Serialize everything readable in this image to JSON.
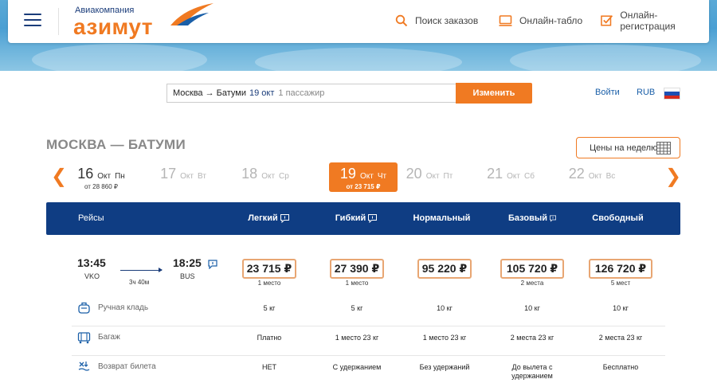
{
  "header": {
    "logo_sub": "Авиакомпания",
    "logo_main": "азимут",
    "nav": [
      {
        "label": "Поиск заказов",
        "icon": "search-icon"
      },
      {
        "label": "Онлайн-табло",
        "icon": "monitor-icon"
      },
      {
        "label": "Онлайн-регистрация",
        "icon": "checkbox-icon"
      }
    ]
  },
  "search": {
    "route": "Москва → Батуми",
    "date": "19 окт",
    "passengers": "1 пассажир",
    "change_label": "Изменить",
    "login_label": "Войти",
    "currency": "RUB"
  },
  "route_title": "МОСКВА — БАТУМИ",
  "week_prices_label": "Цены на неделю",
  "dates": [
    {
      "num": "16",
      "mon": "Окт",
      "wd": "Пн",
      "price": "от 28 860 ₽",
      "state": "avail"
    },
    {
      "num": "17",
      "mon": "Окт",
      "wd": "Вт",
      "price": "",
      "state": "dim"
    },
    {
      "num": "18",
      "mon": "Окт",
      "wd": "Ср",
      "price": "",
      "state": "dim"
    },
    {
      "num": "19",
      "mon": "Окт",
      "wd": "Чт",
      "price": "от 23 715 ₽",
      "state": "sel"
    },
    {
      "num": "20",
      "mon": "Окт",
      "wd": "Пт",
      "price": "",
      "state": "dim"
    },
    {
      "num": "21",
      "mon": "Окт",
      "wd": "Сб",
      "price": "",
      "state": "dim"
    },
    {
      "num": "22",
      "mon": "Окт",
      "wd": "Вс",
      "price": "",
      "state": "dim"
    }
  ],
  "table": {
    "flights_label": "Рейсы",
    "fares": [
      "Легкий",
      "Гибкий",
      "Нормальный",
      "Базовый",
      "Свободный"
    ]
  },
  "flight": {
    "dep_time": "13:45",
    "dep_airport": "VKO",
    "arr_time": "18:25",
    "arr_airport": "BUS",
    "duration": "3ч 40м",
    "prices": [
      "23 715 ₽",
      "27 390 ₽",
      "95 220 ₽",
      "105 720 ₽",
      "126 720 ₽"
    ],
    "seats": [
      "1 место",
      "1 место",
      "",
      "2 места",
      "5 мест"
    ]
  },
  "features": [
    {
      "label": "Ручная кладь",
      "icon": "carry-on-bag-icon",
      "values": [
        "5 кг",
        "5 кг",
        "10 кг",
        "10 кг",
        "10 кг"
      ]
    },
    {
      "label": "Багаж",
      "icon": "luggage-icon",
      "values": [
        "Платно",
        "1 место 23 кг",
        "1 место 23 кг",
        "2 места 23 кг",
        "2 места 23 кг"
      ]
    },
    {
      "label": "Возврат билета",
      "icon": "refund-icon",
      "values": [
        "НЕТ",
        "С удержанием",
        "Без удержаний",
        "До вылета с удержанием",
        "Бесплатно"
      ]
    }
  ],
  "colors": {
    "brand_orange": "#f07a22",
    "brand_blue": "#0f3d83"
  }
}
